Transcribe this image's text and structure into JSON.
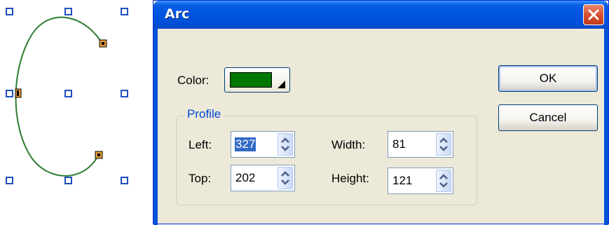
{
  "dialog": {
    "title": "Arc",
    "close_icon": "close-icon",
    "color_label": "Color:",
    "color_value": "#007700",
    "profile": {
      "legend": "Profile",
      "left_label": "Left:",
      "left_value": "327",
      "top_label": "Top:",
      "top_value": "202",
      "width_label": "Width:",
      "width_value": "81",
      "height_label": "Height:",
      "height_value": "121"
    },
    "ok_label": "OK",
    "cancel_label": "Cancel"
  },
  "canvas": {
    "arc_color": "#2e7d32",
    "selection_handle_icon": "square-handle-icon",
    "control_point_icon": "control-point-icon"
  },
  "colors": {
    "titlebar": "#0054e3",
    "dialog_bg": "#ece9d8",
    "group_legend": "#0046d5",
    "selection_highlight": "#316ac5"
  }
}
